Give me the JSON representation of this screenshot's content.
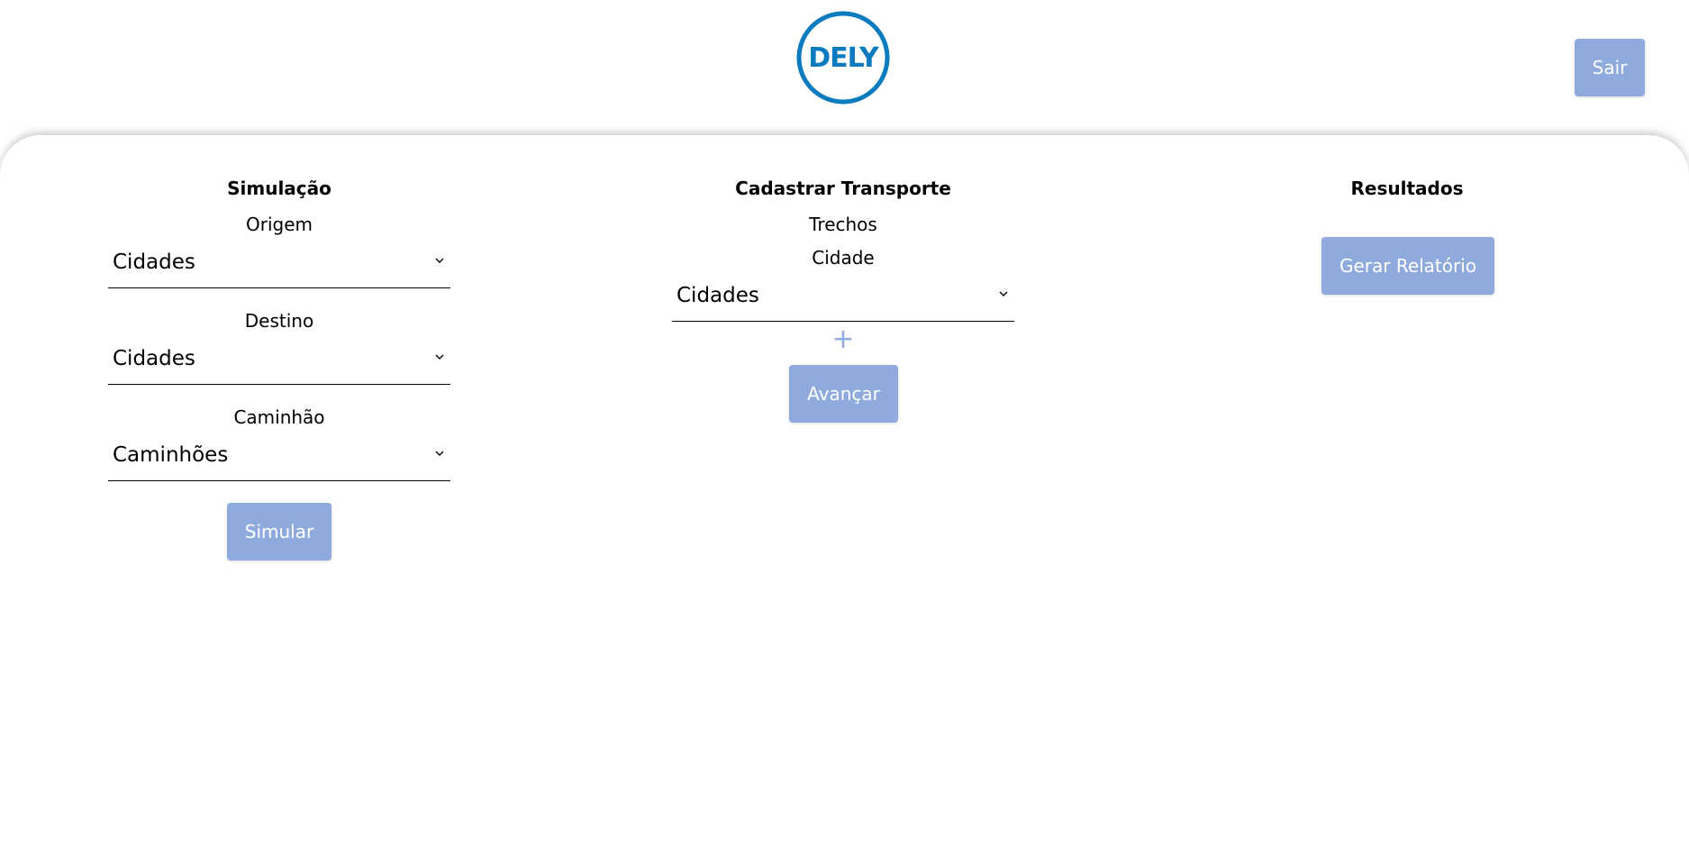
{
  "header": {
    "logo_text": "DELY",
    "logout_label": "Sair",
    "brand_color": "#0a7bbf",
    "button_color": "#8faadc"
  },
  "simulacao": {
    "title": "Simulação",
    "origem_label": "Origem",
    "origem_value": "Cidades",
    "destino_label": "Destino",
    "destino_value": "Cidades",
    "caminhao_label": "Caminhão",
    "caminhao_value": "Caminhões",
    "simular_label": "Simular"
  },
  "cadastro": {
    "title": "Cadastrar Transporte",
    "trechos_label": "Trechos",
    "cidade_label": "Cidade",
    "cidade_value": "Cidades",
    "add_symbol": "+",
    "avancar_label": "Avançar"
  },
  "resultados": {
    "title": "Resultados",
    "gerar_label": "Gerar Relatório"
  },
  "icons": {
    "dropdown": "chevron-down-icon",
    "add": "plus-icon"
  }
}
